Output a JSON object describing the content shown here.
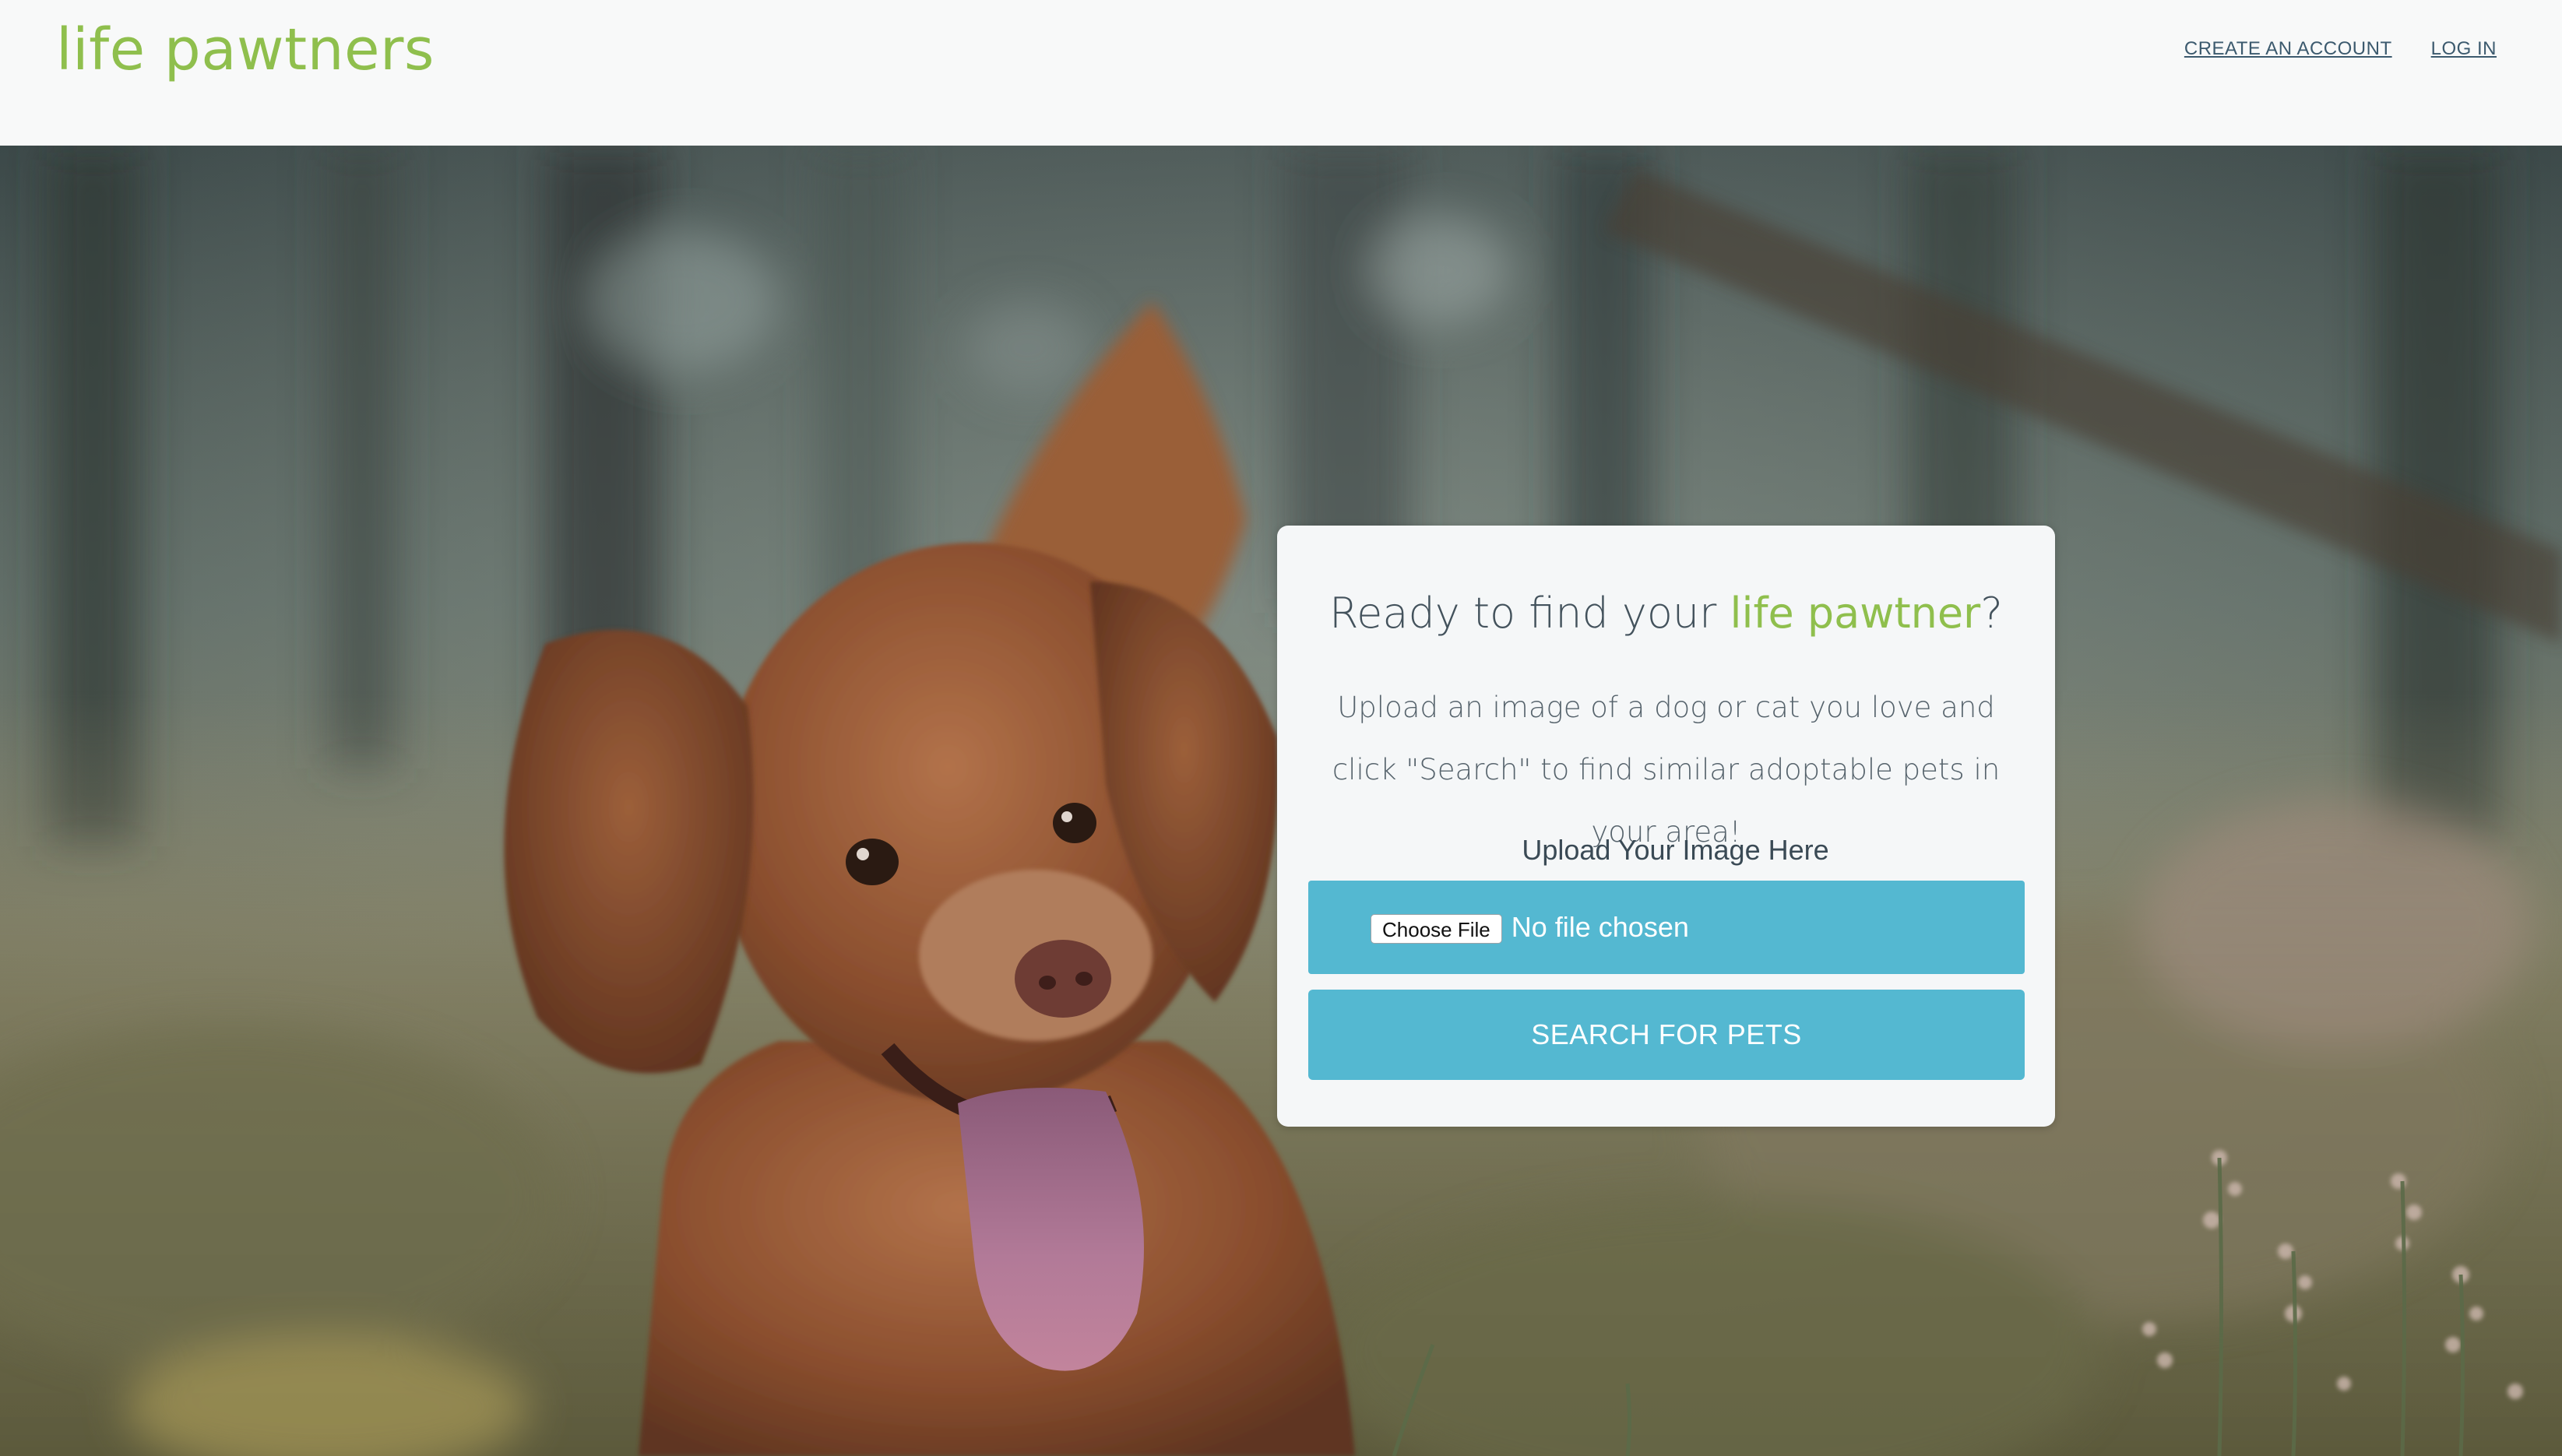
{
  "colors": {
    "brand_green": "#8fbf4d",
    "accent_teal": "#54b8d1",
    "nav_link": "#3c5a6e",
    "heading_text": "#43525c"
  },
  "header": {
    "logo": "life pawtners",
    "nav": {
      "create_account": "CREATE AN ACCOUNT",
      "log_in": "LOG IN"
    }
  },
  "hero": {
    "background_image": "dog-in-meadow-photo"
  },
  "card": {
    "heading_pre": "Ready to find your ",
    "heading_accent": "life pawtner",
    "heading_post": "?",
    "subtitle": "Upload an image of a dog or cat you love and click \"Search\" to find similar adoptable pets in your area!",
    "upload_label": "Upload Your Image Here",
    "choose_file_label": "Choose File",
    "file_status": "No file chosen",
    "search_button": "SEARCH FOR PETS"
  }
}
